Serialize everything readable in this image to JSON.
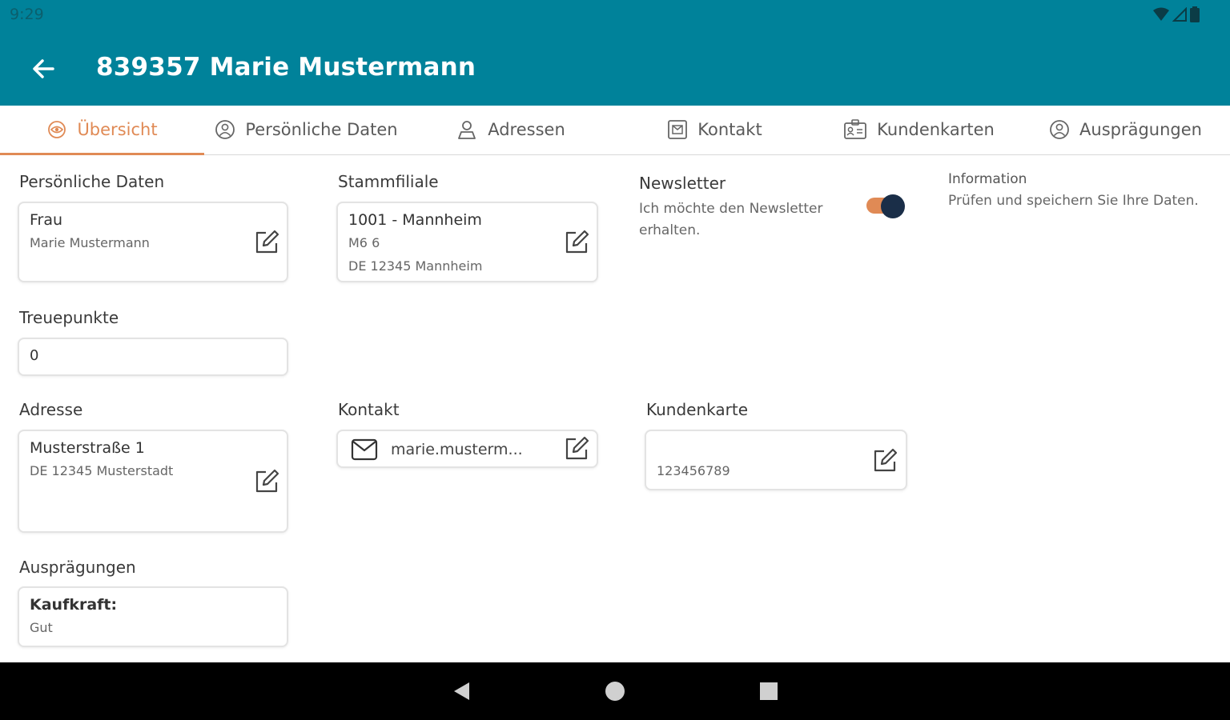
{
  "status_bar": {
    "time": "9:29"
  },
  "header": {
    "title": "839357 Marie Mustermann"
  },
  "tabs": [
    {
      "label": "Übersicht",
      "icon": "eye-icon",
      "active": true
    },
    {
      "label": "Persönliche Daten",
      "icon": "user-circle-icon",
      "active": false
    },
    {
      "label": "Adressen",
      "icon": "location-user-icon",
      "active": false
    },
    {
      "label": "Kontakt",
      "icon": "contact-card-icon",
      "active": false
    },
    {
      "label": "Kundenkarten",
      "icon": "id-card-icon",
      "active": false
    },
    {
      "label": "Ausprägungen",
      "icon": "user-circle-icon",
      "active": false
    }
  ],
  "personal": {
    "label": "Persönliche Daten",
    "salutation": "Frau",
    "name": "Marie Mustermann"
  },
  "branch": {
    "label": "Stammfiliale",
    "name": "1001 - Mannheim",
    "street": "M6 6",
    "city": "DE 12345 Mannheim"
  },
  "newsletter": {
    "label": "Newsletter",
    "description": "Ich möchte den Newsletter erhalten.",
    "enabled": true
  },
  "information": {
    "title": "Information",
    "text": "Prüfen und speichern Sie Ihre Daten."
  },
  "loyalty": {
    "label": "Treuepunkte",
    "value": "0"
  },
  "address": {
    "label": "Adresse",
    "street": "Musterstraße 1",
    "city": "DE 12345 Musterstadt"
  },
  "contact": {
    "label": "Kontakt",
    "email": "marie.musterm..."
  },
  "customer_card": {
    "label": "Kundenkarte",
    "number": "123456789"
  },
  "characteristics": {
    "label": "Ausprägungen",
    "key": "Kaufkraft:",
    "value": "Gut"
  },
  "colors": {
    "primary": "#00829a",
    "accent": "#e08a55",
    "toggle_knob": "#1a2e48"
  }
}
